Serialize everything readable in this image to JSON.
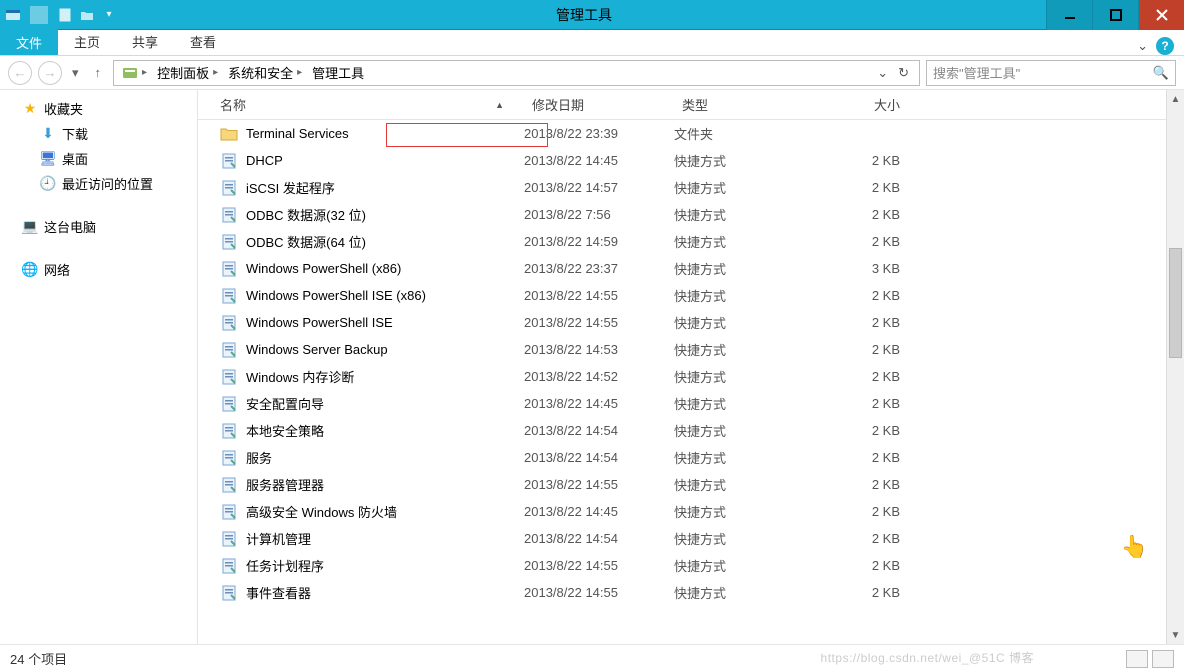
{
  "window": {
    "title": "管理工具"
  },
  "ribbon": {
    "file": "文件",
    "tabs": [
      "主页",
      "共享",
      "查看"
    ]
  },
  "breadcrumb": [
    "控制面板",
    "系统和安全",
    "管理工具"
  ],
  "search_placeholder": "搜索\"管理工具\"",
  "nav": {
    "favorites": "收藏夹",
    "downloads": "下载",
    "desktop": "桌面",
    "recent": "最近访问的位置",
    "thispc": "这台电脑",
    "network": "网络"
  },
  "columns": {
    "name": "名称",
    "date": "修改日期",
    "type": "类型",
    "size": "大小"
  },
  "items": [
    {
      "name": "Terminal Services",
      "date": "2013/8/22 23:39",
      "type": "文件夹",
      "size": ""
    },
    {
      "name": "DHCP",
      "date": "2013/8/22 14:45",
      "type": "快捷方式",
      "size": "2 KB",
      "hl": true
    },
    {
      "name": "iSCSI 发起程序",
      "date": "2013/8/22 14:57",
      "type": "快捷方式",
      "size": "2 KB"
    },
    {
      "name": "ODBC 数据源(32 位)",
      "date": "2013/8/22 7:56",
      "type": "快捷方式",
      "size": "2 KB"
    },
    {
      "name": "ODBC 数据源(64 位)",
      "date": "2013/8/22 14:59",
      "type": "快捷方式",
      "size": "2 KB"
    },
    {
      "name": "Windows PowerShell (x86)",
      "date": "2013/8/22 23:37",
      "type": "快捷方式",
      "size": "3 KB"
    },
    {
      "name": "Windows PowerShell ISE (x86)",
      "date": "2013/8/22 14:55",
      "type": "快捷方式",
      "size": "2 KB"
    },
    {
      "name": "Windows PowerShell ISE",
      "date": "2013/8/22 14:55",
      "type": "快捷方式",
      "size": "2 KB"
    },
    {
      "name": "Windows Server Backup",
      "date": "2013/8/22 14:53",
      "type": "快捷方式",
      "size": "2 KB"
    },
    {
      "name": "Windows 内存诊断",
      "date": "2013/8/22 14:52",
      "type": "快捷方式",
      "size": "2 KB"
    },
    {
      "name": "安全配置向导",
      "date": "2013/8/22 14:45",
      "type": "快捷方式",
      "size": "2 KB"
    },
    {
      "name": "本地安全策略",
      "date": "2013/8/22 14:54",
      "type": "快捷方式",
      "size": "2 KB"
    },
    {
      "name": "服务",
      "date": "2013/8/22 14:54",
      "type": "快捷方式",
      "size": "2 KB"
    },
    {
      "name": "服务器管理器",
      "date": "2013/8/22 14:55",
      "type": "快捷方式",
      "size": "2 KB"
    },
    {
      "name": "高级安全 Windows 防火墙",
      "date": "2013/8/22 14:45",
      "type": "快捷方式",
      "size": "2 KB"
    },
    {
      "name": "计算机管理",
      "date": "2013/8/22 14:54",
      "type": "快捷方式",
      "size": "2 KB"
    },
    {
      "name": "任务计划程序",
      "date": "2013/8/22 14:55",
      "type": "快捷方式",
      "size": "2 KB"
    },
    {
      "name": "事件查看器",
      "date": "2013/8/22 14:55",
      "type": "快捷方式",
      "size": "2 KB"
    }
  ],
  "status": "24 个项目",
  "watermark": "https://blog.csdn.net/wei_@51C 博客"
}
